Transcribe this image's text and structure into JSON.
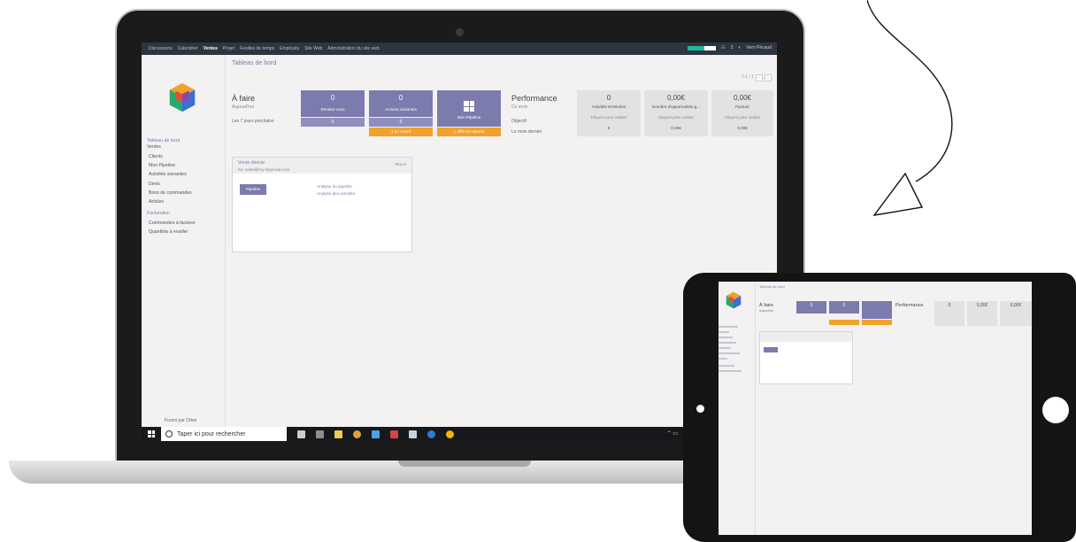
{
  "topnav": {
    "menus": [
      "Discussions",
      "Calendrier",
      "Ventes",
      "Projet",
      "Feuilles de temps",
      "Employés",
      "Site Web",
      "Administration du site web"
    ],
    "active_menu": "Ventes",
    "progress_fraction": 0.6,
    "right_items": [
      "3",
      "Vern Pécaud"
    ]
  },
  "sidebar": {
    "section": "Tableau de bord",
    "ventes_head": "Ventes",
    "ventes_items": [
      "Clients",
      "Mon Pipeline",
      "Activités suivantes",
      "Devis",
      "Bons de commandes",
      "Articles"
    ],
    "facturation_head": "Facturation",
    "facturation_items": [
      "Commandes à facturer",
      "Quantités à ensiller"
    ],
    "powered_by": "Fourni par Odoo"
  },
  "main": {
    "breadcrumb": "Tableau de bord",
    "pager": "1-1 / 1",
    "todo": {
      "title": "À faire",
      "subtitle": "Aujourd'hui",
      "next_label": "Les 7 jours prochains"
    },
    "tiles": {
      "meetings": {
        "value": "0",
        "label": "Rendez-vous",
        "row_value": "0"
      },
      "actions": {
        "value": "0",
        "label": "Actions suivantes",
        "row_value": "0",
        "warn_label": "1 en retard"
      },
      "pipeline": {
        "label": "Mon Pipeline",
        "warn_label": "1 offre en attente"
      }
    },
    "performance": {
      "title": "Performance",
      "subtitle": "Ce mois",
      "target_label": "Objectif",
      "last_month_label": "Le mois dernier",
      "columns": [
        {
          "value": "0",
          "label": "Activités terminées",
          "target": "Cliquez pour valider",
          "last": "0"
        },
        {
          "value": "0,00€",
          "label": "Nombre d'opportunités g...",
          "target": "Cliquez pour valider",
          "last": "0,00€"
        },
        {
          "value": "0,00€",
          "label": "Facturé",
          "target": "Cliquez pour valider",
          "last": "0,00€"
        }
      ]
    },
    "team": {
      "name": "Vente directe",
      "email": "Ex: sales@my-sipyroad.com",
      "more": "Plus ▾",
      "button": "Pipeline",
      "links": [
        "Analyse du pipeline",
        "Analyse des activités"
      ]
    }
  },
  "taskbar": {
    "search_placeholder": "Taper ici pour rechercher"
  },
  "colors": {
    "primary": "#7c7bad",
    "warning": "#f0a22b",
    "topbar": "#2f3540",
    "accent_progress": "#21b799"
  }
}
